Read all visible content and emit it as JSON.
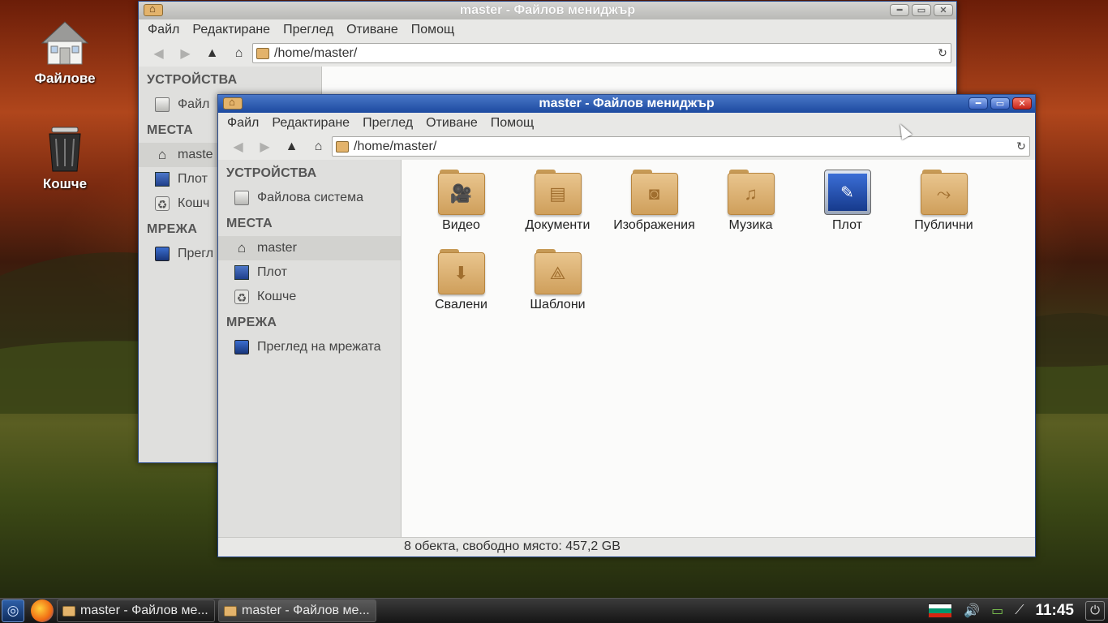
{
  "desktop": {
    "icons": [
      {
        "label": "Файлове",
        "icon": "home-folder-icon"
      },
      {
        "label": "Кошче",
        "icon": "trash-icon"
      }
    ]
  },
  "back_window": {
    "title": "master - Файлов мениджър",
    "menu": [
      "Файл",
      "Редактиране",
      "Преглед",
      "Отиване",
      "Помощ"
    ],
    "path": "/home/master/",
    "sidebar": {
      "devices_heading": "УСТРОЙСТВА",
      "devices": [
        "Файл"
      ],
      "places_heading": "МЕСТА",
      "places": [
        "maste",
        "Плот",
        "Кошч"
      ],
      "network_heading": "МРЕЖА",
      "network": [
        "Прегл"
      ]
    }
  },
  "front_window": {
    "title": "master - Файлов мениджър",
    "menu": [
      "Файл",
      "Редактиране",
      "Преглед",
      "Отиване",
      "Помощ"
    ],
    "path": "/home/master/",
    "sidebar": {
      "devices_heading": "УСТРОЙСТВА",
      "devices": [
        "Файлова система"
      ],
      "places_heading": "МЕСТА",
      "places": [
        "master",
        "Плот",
        "Кошче"
      ],
      "network_heading": "МРЕЖА",
      "network": [
        "Преглед на мрежата"
      ]
    },
    "files": [
      {
        "label": "Видео",
        "icon": "video-folder-icon",
        "glyph": "🎥"
      },
      {
        "label": "Документи",
        "icon": "documents-folder-icon",
        "glyph": "▤"
      },
      {
        "label": "Изображения",
        "icon": "pictures-folder-icon",
        "glyph": "◙"
      },
      {
        "label": "Музика",
        "icon": "music-folder-icon",
        "glyph": "♫"
      },
      {
        "label": "Плот",
        "icon": "desktop-icon",
        "glyph": "✎"
      },
      {
        "label": "Публични",
        "icon": "public-folder-icon",
        "glyph": "⤳"
      },
      {
        "label": "Свалени",
        "icon": "downloads-folder-icon",
        "glyph": "⬇"
      },
      {
        "label": "Шаблони",
        "icon": "templates-folder-icon",
        "glyph": "⟁"
      }
    ],
    "status": "8 обекта, свободно място: 457,2 GB"
  },
  "taskbar": {
    "tasks": [
      "master - Файлов ме...",
      "master - Файлов ме..."
    ],
    "clock": "11:45",
    "flag_colors": [
      "#ffffff",
      "#00966e",
      "#d62612"
    ]
  }
}
